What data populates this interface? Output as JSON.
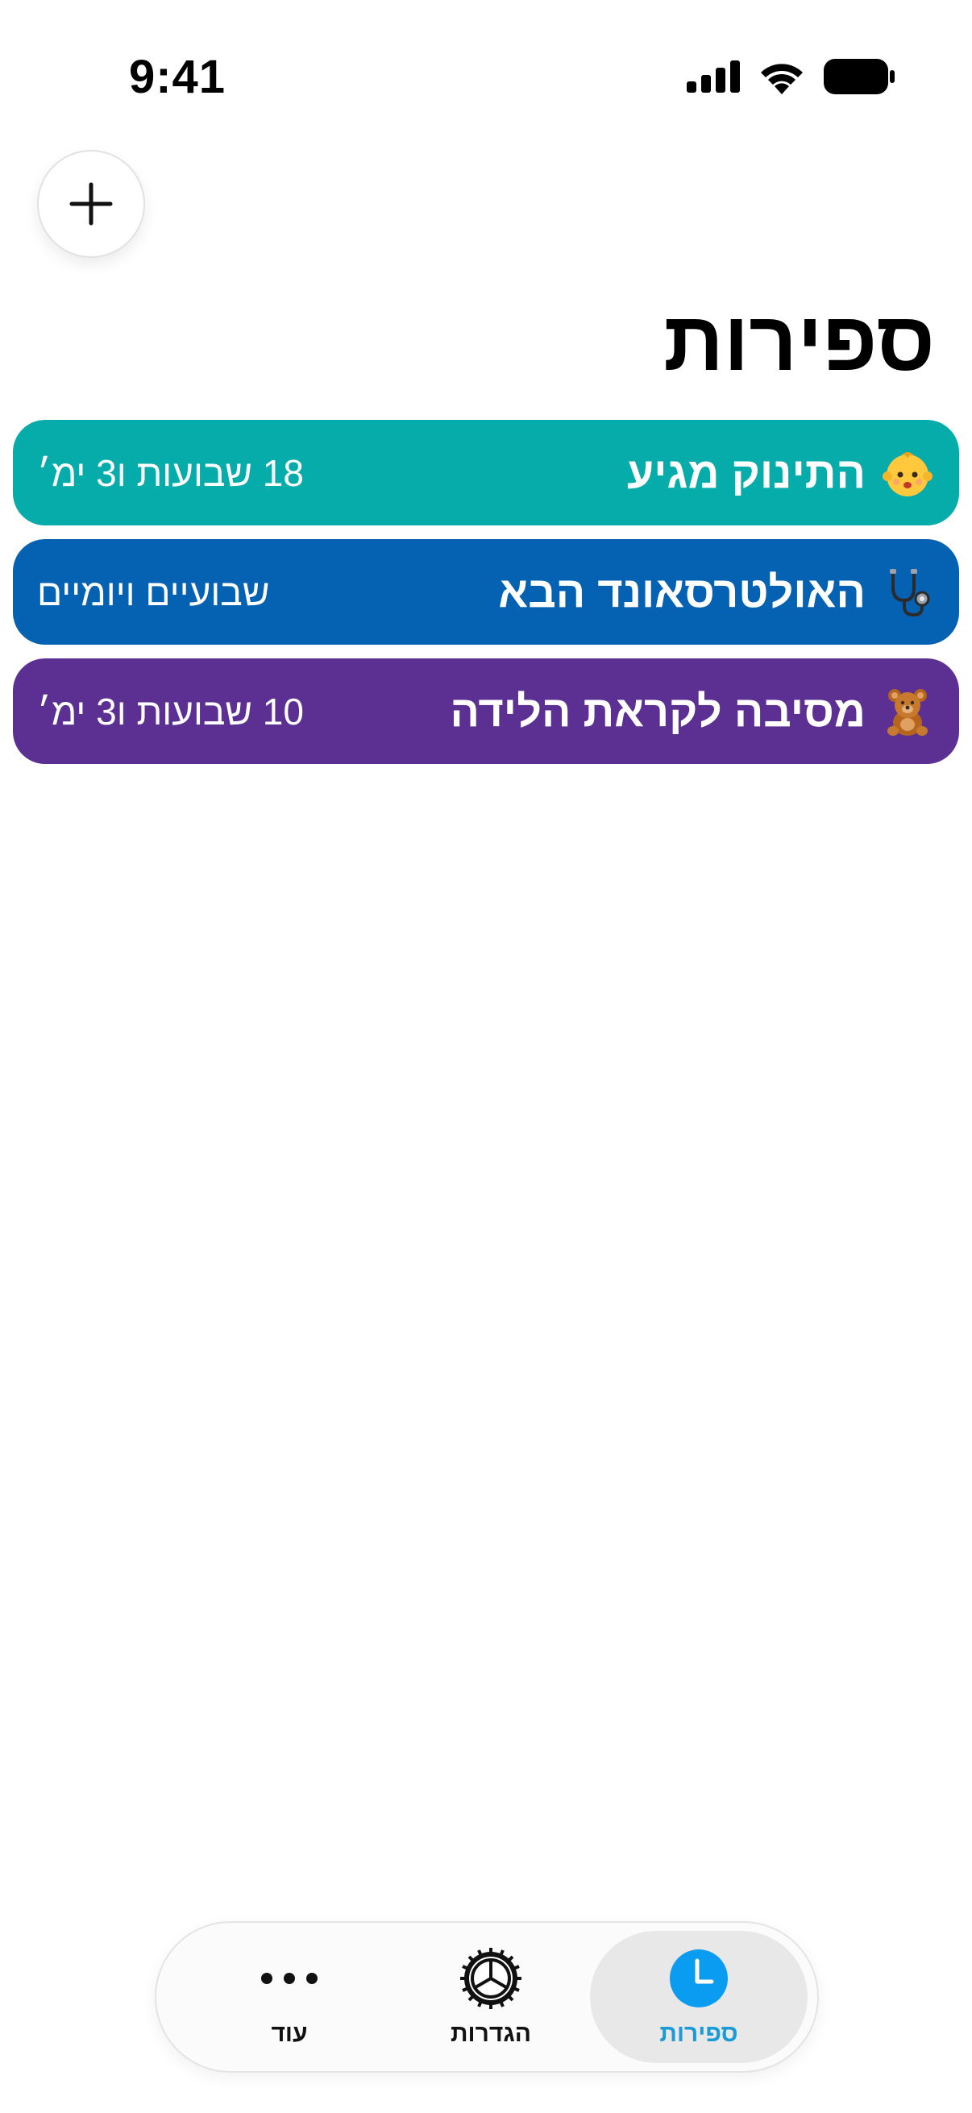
{
  "status_bar": {
    "time": "9:41"
  },
  "header": {
    "add_icon": "plus-icon",
    "title": "ספירות"
  },
  "counters": [
    {
      "title": "התינוק מגיע",
      "value": "18 שבועות ו3 ימ׳",
      "emoji": "baby-face",
      "color": "#05ACAA"
    },
    {
      "title": "האולטרסאונד הבא",
      "value": "שבועיים ויומיים",
      "emoji": "stethoscope",
      "color": "#0561B1"
    },
    {
      "title": "מסיבה לקראת הלידה",
      "value": "10 שבועות ו3 ימ׳",
      "emoji": "teddy-bear",
      "color": "#5B3092"
    }
  ],
  "tab_bar": {
    "tabs": [
      {
        "label": "ספירות",
        "icon": "clock-icon",
        "selected": true
      },
      {
        "label": "הגדרות",
        "icon": "gear-icon",
        "selected": false
      },
      {
        "label": "עוד",
        "icon": "more-icon",
        "selected": false
      }
    ],
    "accent": "#0A9CF0"
  }
}
